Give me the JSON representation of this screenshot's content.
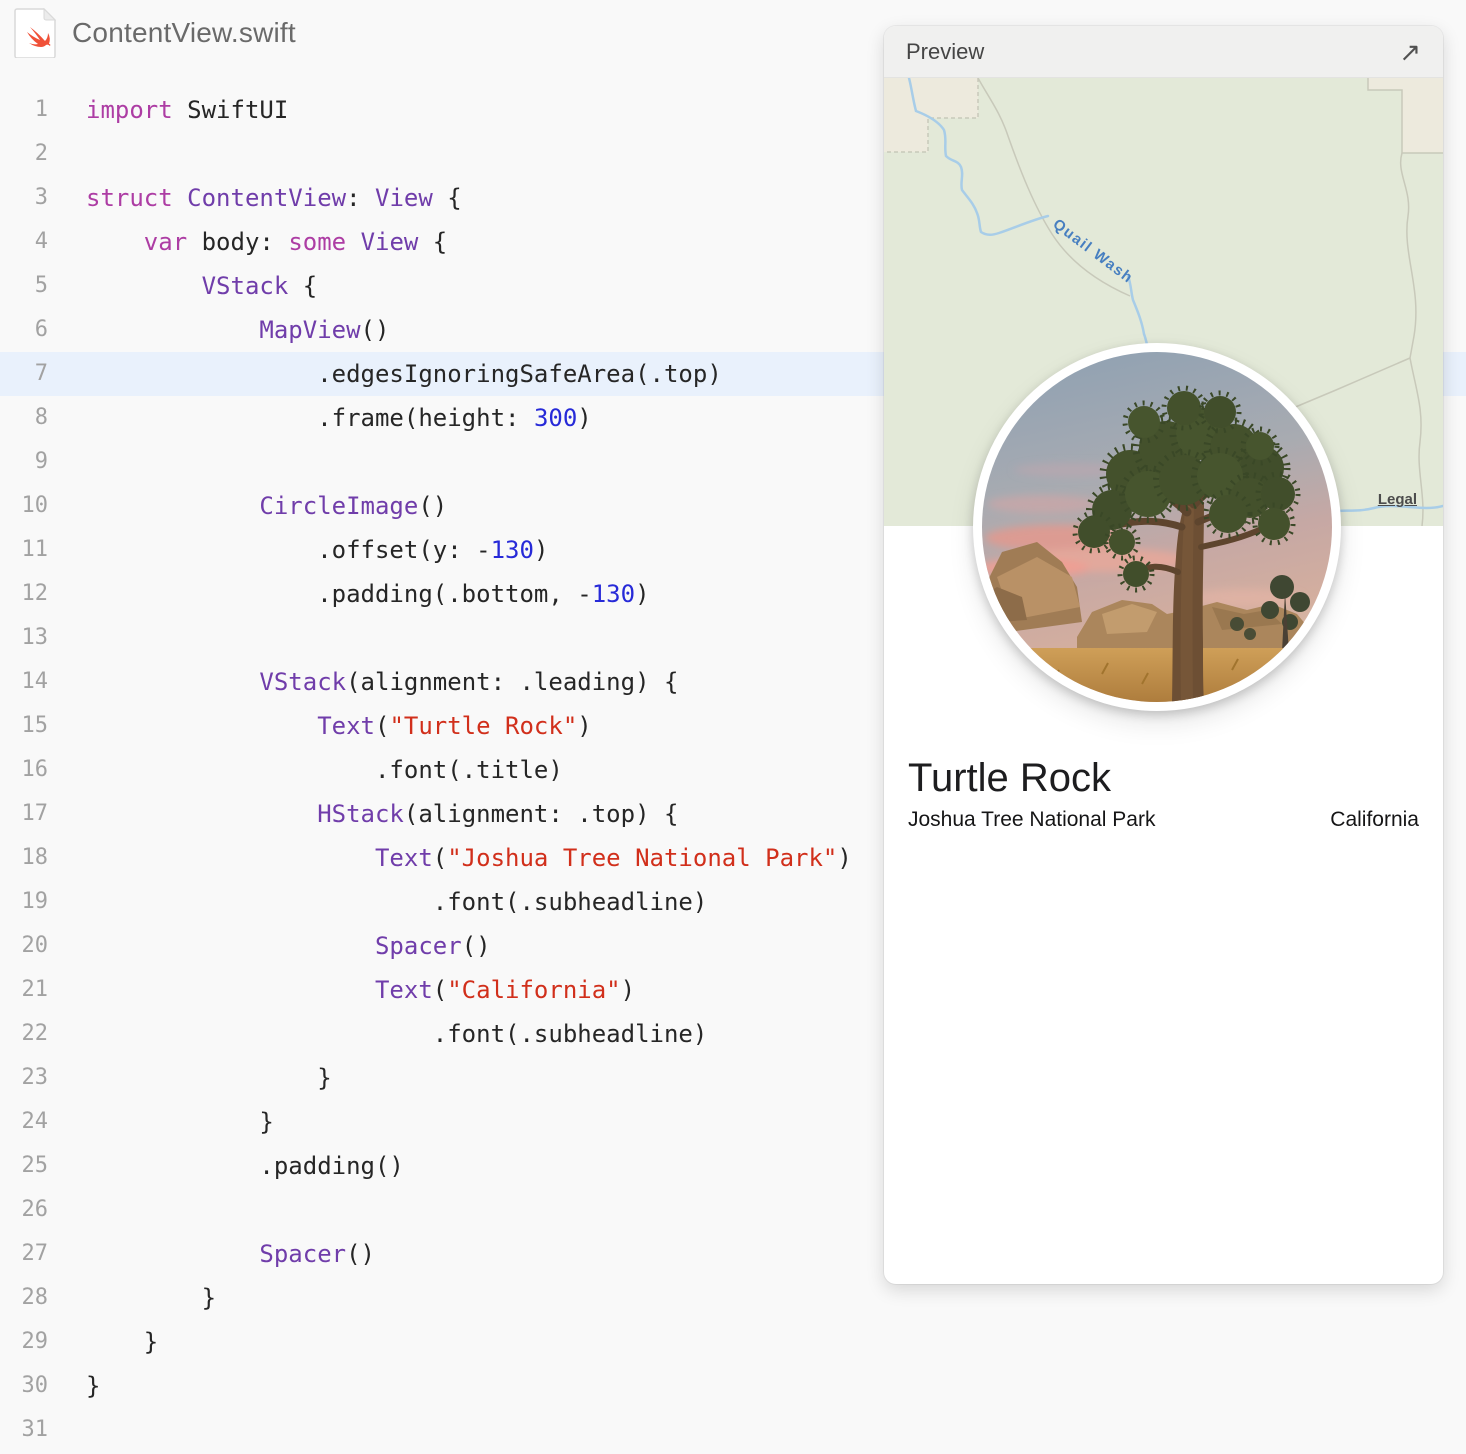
{
  "window": {
    "title": "ContentView.swift"
  },
  "editor": {
    "lines": [
      {
        "n": 1,
        "indent": 0,
        "tokens": [
          [
            "k",
            "import"
          ],
          [
            "p",
            " SwiftUI"
          ]
        ]
      },
      {
        "n": 2,
        "indent": 0,
        "tokens": []
      },
      {
        "n": 3,
        "indent": 0,
        "tokens": [
          [
            "k",
            "struct"
          ],
          [
            "p",
            " "
          ],
          [
            "t",
            "ContentView"
          ],
          [
            "p",
            ": "
          ],
          [
            "t",
            "View"
          ],
          [
            "p",
            " {"
          ]
        ]
      },
      {
        "n": 4,
        "indent": 4,
        "tokens": [
          [
            "k",
            "var"
          ],
          [
            "p",
            " body: "
          ],
          [
            "k",
            "some"
          ],
          [
            "p",
            " "
          ],
          [
            "t",
            "View"
          ],
          [
            "p",
            " {"
          ]
        ]
      },
      {
        "n": 5,
        "indent": 8,
        "tokens": [
          [
            "t",
            "VStack"
          ],
          [
            "p",
            " {"
          ]
        ]
      },
      {
        "n": 6,
        "indent": 12,
        "tokens": [
          [
            "t",
            "MapView"
          ],
          [
            "p",
            "()"
          ]
        ]
      },
      {
        "n": 7,
        "indent": 16,
        "highlight": true,
        "tokens": [
          [
            "p",
            ".edgesIgnoringSafeArea(.top)"
          ]
        ]
      },
      {
        "n": 8,
        "indent": 16,
        "tokens": [
          [
            "p",
            ".frame(height: "
          ],
          [
            "n",
            "300"
          ],
          [
            "p",
            ")"
          ]
        ]
      },
      {
        "n": 9,
        "indent": 0,
        "tokens": []
      },
      {
        "n": 10,
        "indent": 12,
        "tokens": [
          [
            "t",
            "CircleImage"
          ],
          [
            "p",
            "()"
          ]
        ]
      },
      {
        "n": 11,
        "indent": 16,
        "tokens": [
          [
            "p",
            ".offset(y: -"
          ],
          [
            "n",
            "130"
          ],
          [
            "p",
            ")"
          ]
        ]
      },
      {
        "n": 12,
        "indent": 16,
        "tokens": [
          [
            "p",
            ".padding(.bottom, -"
          ],
          [
            "n",
            "130"
          ],
          [
            "p",
            ")"
          ]
        ]
      },
      {
        "n": 13,
        "indent": 0,
        "tokens": []
      },
      {
        "n": 14,
        "indent": 12,
        "tokens": [
          [
            "t",
            "VStack"
          ],
          [
            "p",
            "(alignment: .leading) {"
          ]
        ]
      },
      {
        "n": 15,
        "indent": 16,
        "tokens": [
          [
            "t",
            "Text"
          ],
          [
            "p",
            "("
          ],
          [
            "s",
            "\"Turtle Rock\""
          ],
          [
            "p",
            ")"
          ]
        ]
      },
      {
        "n": 16,
        "indent": 20,
        "tokens": [
          [
            "p",
            ".font(.title)"
          ]
        ]
      },
      {
        "n": 17,
        "indent": 16,
        "tokens": [
          [
            "t",
            "HStack"
          ],
          [
            "p",
            "(alignment: .top) {"
          ]
        ]
      },
      {
        "n": 18,
        "indent": 20,
        "tokens": [
          [
            "t",
            "Text"
          ],
          [
            "p",
            "("
          ],
          [
            "s",
            "\"Joshua Tree National Park\""
          ],
          [
            "p",
            ")"
          ]
        ]
      },
      {
        "n": 19,
        "indent": 24,
        "tokens": [
          [
            "p",
            ".font(.subheadline)"
          ]
        ]
      },
      {
        "n": 20,
        "indent": 20,
        "tokens": [
          [
            "t",
            "Spacer"
          ],
          [
            "p",
            "()"
          ]
        ]
      },
      {
        "n": 21,
        "indent": 20,
        "tokens": [
          [
            "t",
            "Text"
          ],
          [
            "p",
            "("
          ],
          [
            "s",
            "\"California\""
          ],
          [
            "p",
            ")"
          ]
        ]
      },
      {
        "n": 22,
        "indent": 24,
        "tokens": [
          [
            "p",
            ".font(.subheadline)"
          ]
        ]
      },
      {
        "n": 23,
        "indent": 16,
        "tokens": [
          [
            "p",
            "}"
          ]
        ]
      },
      {
        "n": 24,
        "indent": 12,
        "tokens": [
          [
            "p",
            "}"
          ]
        ]
      },
      {
        "n": 25,
        "indent": 12,
        "tokens": [
          [
            "p",
            ".padding()"
          ]
        ]
      },
      {
        "n": 26,
        "indent": 0,
        "tokens": []
      },
      {
        "n": 27,
        "indent": 12,
        "tokens": [
          [
            "t",
            "Spacer"
          ],
          [
            "p",
            "()"
          ]
        ]
      },
      {
        "n": 28,
        "indent": 8,
        "tokens": [
          [
            "p",
            "}"
          ]
        ]
      },
      {
        "n": 29,
        "indent": 4,
        "tokens": [
          [
            "p",
            "}"
          ]
        ]
      },
      {
        "n": 30,
        "indent": 0,
        "tokens": [
          [
            "p",
            "}"
          ]
        ]
      },
      {
        "n": 31,
        "indent": 0,
        "tokens": []
      }
    ]
  },
  "preview": {
    "header_label": "Preview",
    "expand_icon": "↗",
    "map": {
      "stream_label": "Quail Wash",
      "legal_label": "Legal"
    },
    "landmark": {
      "title": "Turtle Rock",
      "park": "Joshua Tree National Park",
      "state": "California"
    }
  },
  "colors": {
    "page_bg": "#f9f9f9",
    "code_plain": "#262626",
    "code_keyword": "#ad3da4",
    "code_type": "#703daa",
    "code_number": "#272ad8",
    "code_string": "#d12f1b",
    "line_number": "#a2a2a2",
    "highlight_row": "#e9f1fc",
    "card_bg": "#ffffff",
    "preview_header_bg": "#f0f0ef",
    "title_gray": "#6a6a6a",
    "map_green": "#e3e9d8",
    "map_beige": "#edeadd",
    "map_boundary": "#c8c9ba",
    "stream_blue": "#a8cde8",
    "stream_label_blue": "#477fc0",
    "swift_orange": "#f05138"
  }
}
